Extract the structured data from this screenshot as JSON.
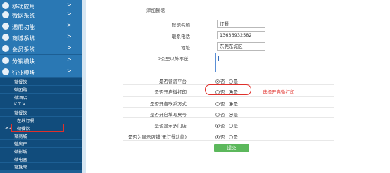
{
  "sidebar": {
    "categories": [
      {
        "label": "移动应用",
        "arrow": ">"
      },
      {
        "label": "微网系统",
        "arrow": ">"
      },
      {
        "label": "通用功能",
        "arrow": ">"
      },
      {
        "label": "商城系统",
        "arrow": ">"
      },
      {
        "label": "会员系统",
        "arrow": ">"
      },
      {
        "label": "分销模块",
        "arrow": ">"
      },
      {
        "label": "行业模块",
        "arrow": ">"
      }
    ],
    "sub_items": [
      "微餐饮",
      "微团购",
      "微酒店",
      "K T V",
      "微餐饮",
      "在线订餐",
      "微餐饮",
      "微商城",
      "微房产",
      "微影城",
      "微电器",
      "微珠宝"
    ],
    "marker": ">>"
  },
  "form": {
    "section_title": "添加餐馆",
    "fields": [
      {
        "label": "餐馆名称",
        "value": "订餐"
      },
      {
        "label": "联系电话",
        "value": "13636932582"
      },
      {
        "label": "地址",
        "value": "东莞东城区"
      }
    ],
    "description_label": "2公里以外不送!",
    "options": [
      {
        "label": "是否营游平台",
        "yes": "是",
        "no": "否",
        "selected": "no"
      },
      {
        "label": "是否开启微打印",
        "yes": "是",
        "no": "否",
        "selected": "yes"
      },
      {
        "label": "是否开启联系方式",
        "yes": "是",
        "no": "否",
        "selected": "yes"
      },
      {
        "label": "是否开启填写桌号",
        "yes": "是",
        "no": "否",
        "selected": "yes"
      },
      {
        "label": "是否显示多门店",
        "yes": "是",
        "no": "否",
        "selected": "no"
      },
      {
        "label": "是否为展示店铺(无订餐功能)",
        "yes": "是",
        "no": "否",
        "selected": "no"
      }
    ],
    "annotation": "选择开启微打印",
    "submit_label": "提交"
  },
  "colors": {
    "sidebar_bg": "#1d5f94",
    "category_bg": "#2a78b4",
    "highlight": "#e0302b",
    "submit_bg": "#5cb85c"
  }
}
